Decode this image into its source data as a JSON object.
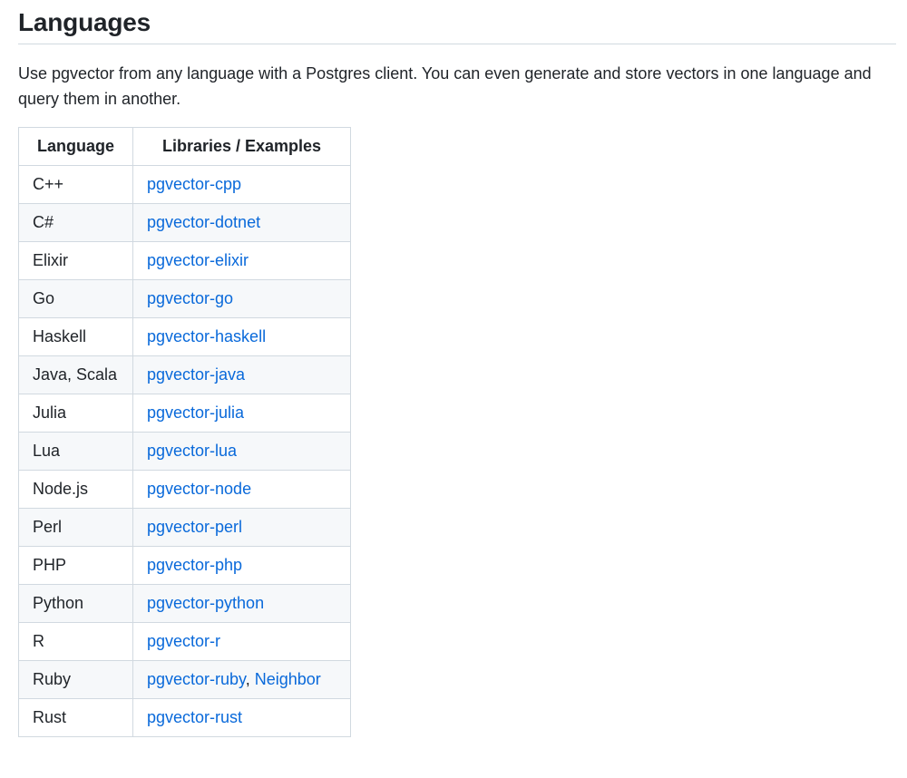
{
  "title": "Languages",
  "intro": "Use pgvector from any language with a Postgres client. You can even generate and store vectors in one language and query them in another.",
  "table": {
    "headers": [
      "Language",
      "Libraries / Examples"
    ],
    "rows": [
      {
        "language": "C++",
        "libraries": [
          "pgvector-cpp"
        ]
      },
      {
        "language": "C#",
        "libraries": [
          "pgvector-dotnet"
        ]
      },
      {
        "language": "Elixir",
        "libraries": [
          "pgvector-elixir"
        ]
      },
      {
        "language": "Go",
        "libraries": [
          "pgvector-go"
        ]
      },
      {
        "language": "Haskell",
        "libraries": [
          "pgvector-haskell"
        ]
      },
      {
        "language": "Java, Scala",
        "libraries": [
          "pgvector-java"
        ]
      },
      {
        "language": "Julia",
        "libraries": [
          "pgvector-julia"
        ]
      },
      {
        "language": "Lua",
        "libraries": [
          "pgvector-lua"
        ]
      },
      {
        "language": "Node.js",
        "libraries": [
          "pgvector-node"
        ]
      },
      {
        "language": "Perl",
        "libraries": [
          "pgvector-perl"
        ]
      },
      {
        "language": "PHP",
        "libraries": [
          "pgvector-php"
        ]
      },
      {
        "language": "Python",
        "libraries": [
          "pgvector-python"
        ]
      },
      {
        "language": "R",
        "libraries": [
          "pgvector-r"
        ]
      },
      {
        "language": "Ruby",
        "libraries": [
          "pgvector-ruby",
          "Neighbor"
        ]
      },
      {
        "language": "Rust",
        "libraries": [
          "pgvector-rust"
        ]
      }
    ]
  },
  "colors": {
    "link": "#0969da",
    "text": "#1f2328",
    "border": "#d1d9e0",
    "stripe": "#f6f8fa"
  }
}
